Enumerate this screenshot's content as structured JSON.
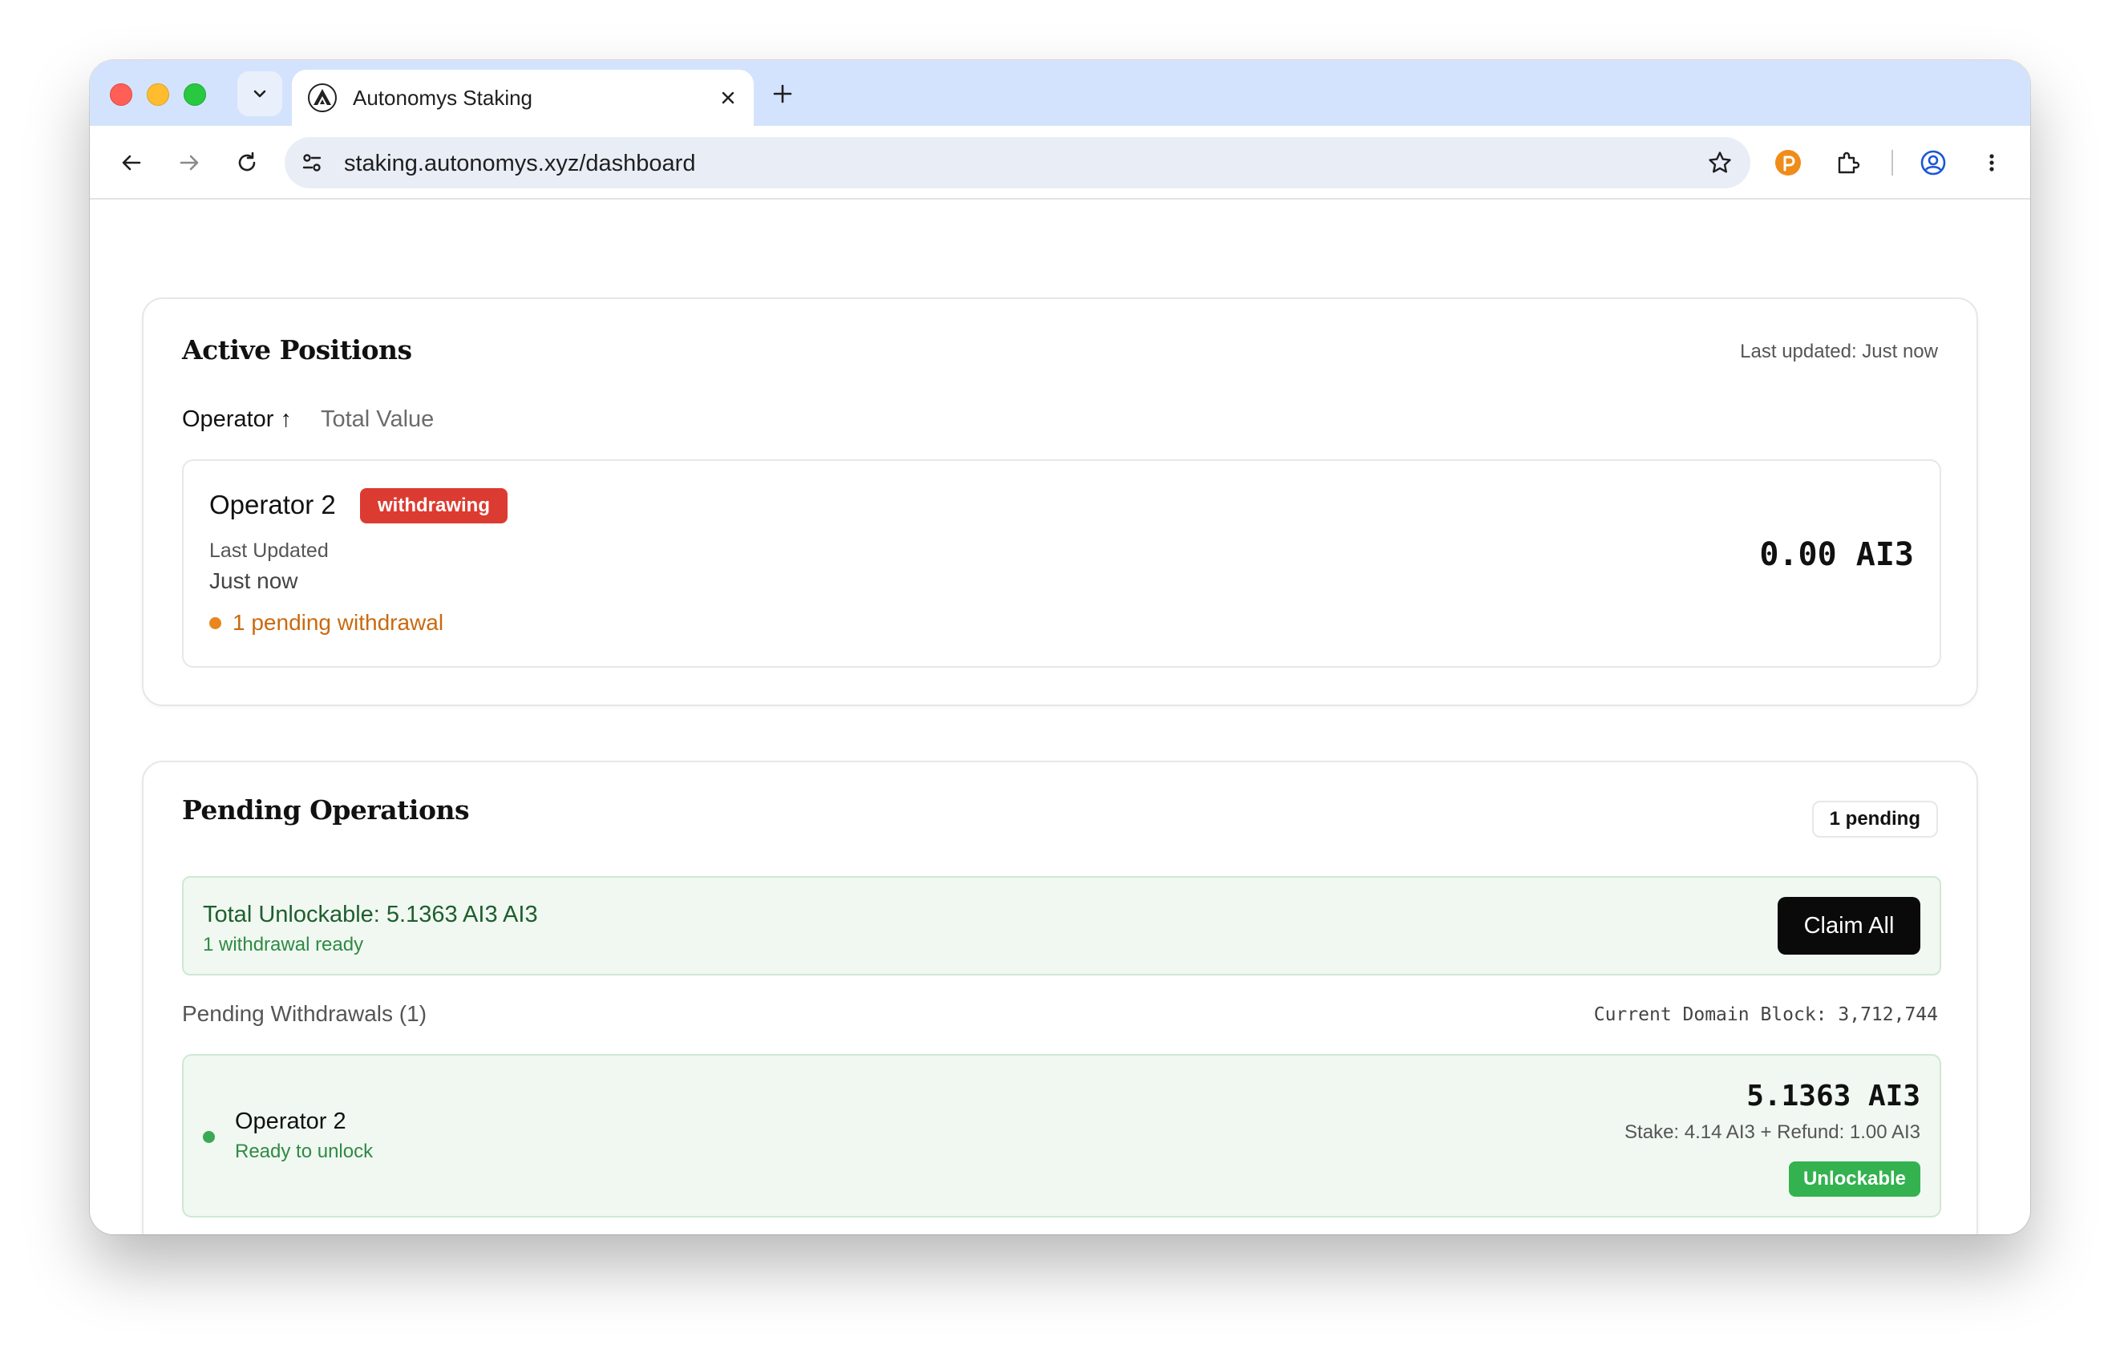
{
  "browser": {
    "tab_title": "Autonomys Staking",
    "url": "staking.autonomys.xyz/dashboard"
  },
  "active_positions": {
    "title": "Active Positions",
    "last_updated": "Last updated: Just now",
    "sort": {
      "operator_label": "Operator",
      "operator_arrow": "↑",
      "total_value_label": "Total Value"
    },
    "positions": [
      {
        "name": "Operator 2",
        "status_badge": "withdrawing",
        "last_updated_label": "Last Updated",
        "last_updated_value": "Just now",
        "pending_note": "1 pending withdrawal",
        "value": "0.00 AI3"
      }
    ]
  },
  "pending_operations": {
    "title": "Pending Operations",
    "count_badge": "1 pending",
    "banner": {
      "total": "Total Unlockable: 5.1363 AI3 AI3",
      "subtitle": "1 withdrawal ready",
      "claim_label": "Claim All"
    },
    "withdrawals_title": "Pending Withdrawals (1)",
    "domain_block": "Current Domain Block: 3,712,744",
    "withdrawals": [
      {
        "name": "Operator 2",
        "status": "Ready to unlock",
        "amount": "5.1363 AI3",
        "breakdown": "Stake: 4.14 AI3 + Refund: 1.00 AI3",
        "badge": "Unlockable"
      }
    ]
  },
  "colors": {
    "tab_strip": "#d3e3fd",
    "withdrawing_badge": "#dc3b31",
    "pending_orange": "#c96a0f",
    "success_green": "#33b24f",
    "banner_bg": "#f0f8f1"
  }
}
